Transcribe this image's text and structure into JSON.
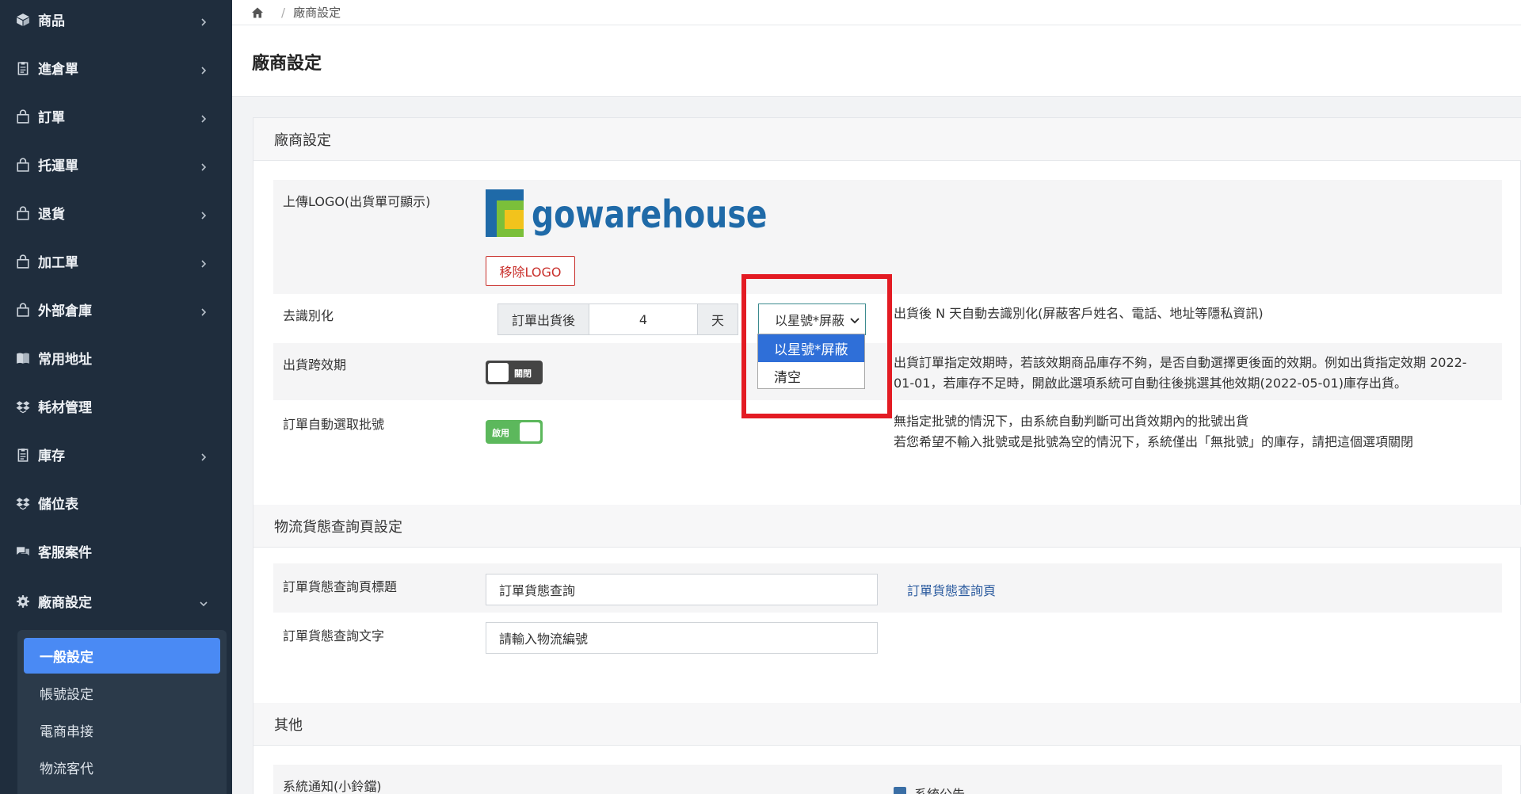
{
  "sidebar": {
    "items": [
      {
        "label": "商品",
        "icon": "cube-icon"
      },
      {
        "label": "進倉單",
        "icon": "clipboard-icon"
      },
      {
        "label": "訂單",
        "icon": "bag-icon"
      },
      {
        "label": "托運單",
        "icon": "bag-icon"
      },
      {
        "label": "退貨",
        "icon": "bag-icon"
      },
      {
        "label": "加工單",
        "icon": "bag-icon"
      },
      {
        "label": "外部倉庫",
        "icon": "bag-icon"
      },
      {
        "label": "常用地址",
        "icon": "book-icon"
      },
      {
        "label": "耗材管理",
        "icon": "dropbox-icon"
      },
      {
        "label": "庫存",
        "icon": "clipboard-icon"
      },
      {
        "label": "儲位表",
        "icon": "dropbox-icon"
      },
      {
        "label": "客服案件",
        "icon": "comments-icon"
      },
      {
        "label": "廠商設定",
        "icon": "gear-icon"
      }
    ],
    "submenu": [
      {
        "label": "一般設定"
      },
      {
        "label": "帳號設定"
      },
      {
        "label": "電商串接"
      },
      {
        "label": "物流客代"
      }
    ]
  },
  "breadcrumb": {
    "current": "廠商設定"
  },
  "page": {
    "title": "廠商設定"
  },
  "sections": {
    "vendor": {
      "title": "廠商設定",
      "logo_label": "上傳LOGO(出貨單可顯示)",
      "logo_text": "gowarehouse",
      "remove_logo": "移除LOGO",
      "deid_label": "去識別化",
      "deid_prefix": "訂單出貨後",
      "deid_days": "4",
      "deid_suffix": "天",
      "deid_select_value": "以星號*屏蔽",
      "deid_options": [
        "以星號*屏蔽",
        "清空"
      ],
      "deid_desc": "出貨後 N 天自動去識別化(屏蔽客戶姓名、電話、地址等隱私資訊)",
      "cross_expiry_label": "出貨跨效期",
      "cross_expiry_toggle": "關閉",
      "cross_expiry_desc_1": "出貨訂單指定效期時，若該效期商品庫存不夠，是否自動選擇更後面的效期。例如出貨指定效期 2022-",
      "cross_expiry_desc_2": "01-01，若庫存不足時，開啟此選項系統可自動往後挑選其他效期(2022-05-01)庫存出貨。",
      "auto_batch_label": "訂單自動選取批號",
      "auto_batch_toggle": "啟用",
      "auto_batch_desc_1": "無指定批號的情況下，由系統自動判斷可出貨效期內的批號出貨",
      "auto_batch_desc_2": "若您希望不輸入批號或是批號為空的情況下，系統僅出「無批號」的庫存，請把這個選項關閉"
    },
    "logistics": {
      "title": "物流貨態查詢頁設定",
      "page_title_label": "訂單貨態查詢頁標題",
      "page_title_value": "訂單貨態查詢",
      "page_link": "訂單貨態查詢頁",
      "query_text_label": "訂單貨態查詢文字",
      "query_text_value": "請輸入物流編號"
    },
    "other": {
      "title": "其他",
      "notify_label": "系統通知(小鈴鐺)",
      "notify_checkbox": "系統公告"
    }
  }
}
